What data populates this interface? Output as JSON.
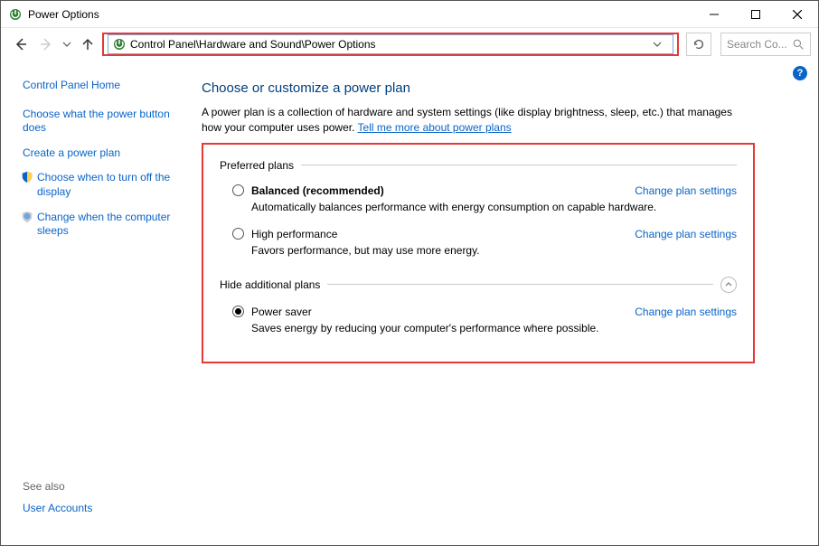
{
  "window": {
    "title": "Power Options"
  },
  "nav": {
    "address_path": "Control Panel\\Hardware and Sound\\Power Options",
    "search_placeholder": "Search Co..."
  },
  "sidebar": {
    "home": "Control Panel Home",
    "links": [
      {
        "label": "Choose what the power button does"
      },
      {
        "label": "Create a power plan"
      },
      {
        "label": "Choose when to turn off the display",
        "shield": true
      },
      {
        "label": "Change when the computer sleeps",
        "shield": true
      }
    ],
    "see_also_label": "See also",
    "see_also_links": [
      "User Accounts"
    ]
  },
  "content": {
    "heading": "Choose or customize a power plan",
    "intro_text": "A power plan is a collection of hardware and system settings (like display brightness, sleep, etc.) that manages how your computer uses power. ",
    "intro_link": "Tell me more about power plans",
    "preferred_plans_title": "Preferred plans",
    "hide_additional_title": "Hide additional plans",
    "change_settings_label": "Change plan settings",
    "plans": {
      "balanced": {
        "name": "Balanced (recommended)",
        "desc": "Automatically balances performance with energy consumption on capable hardware."
      },
      "high_perf": {
        "name": "High performance",
        "desc": "Favors performance, but may use more energy."
      },
      "power_saver": {
        "name": "Power saver",
        "desc": "Saves energy by reducing your computer's performance where possible."
      }
    }
  }
}
